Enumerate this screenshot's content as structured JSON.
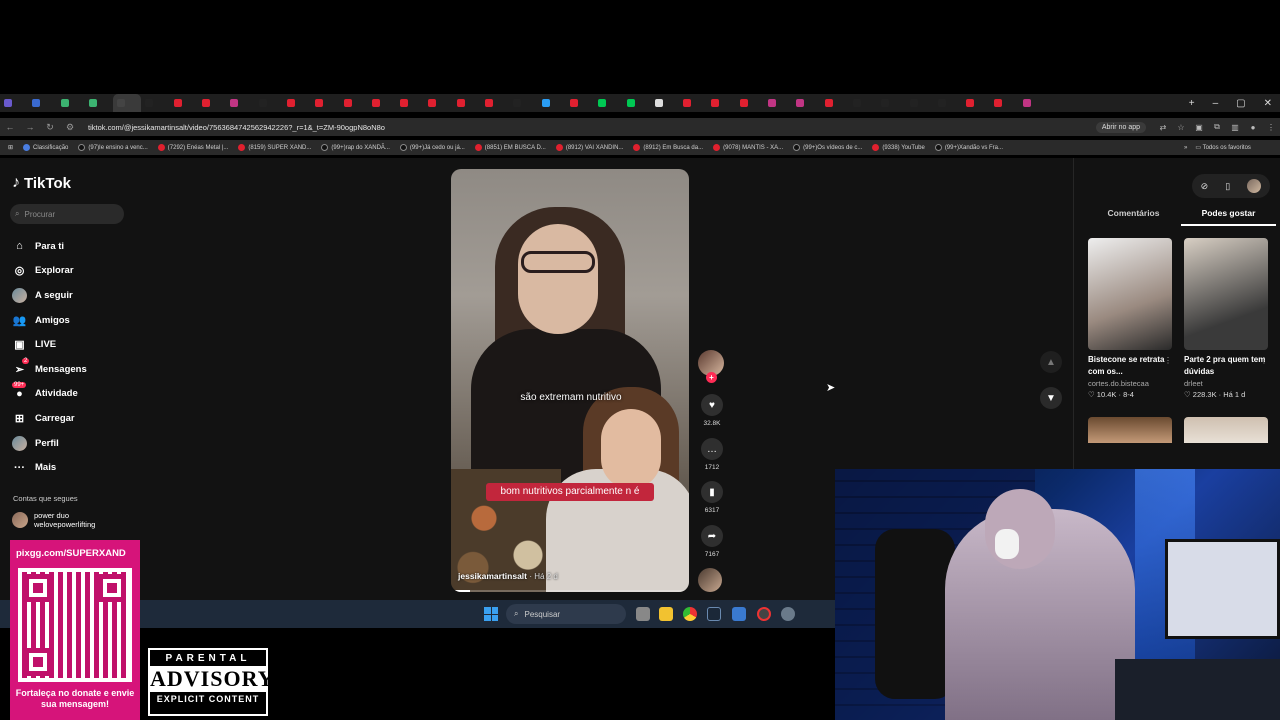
{
  "browser": {
    "url": "tiktok.com/@jessikamartinsalt/video/7563684742562942226?_r=1&_t=ZM-90ogpN8oN8o",
    "open_in_app": "Abrir no app",
    "bookmarks": [
      {
        "label": "Classificação",
        "kind": "g"
      },
      {
        "label": "(97)Ie ensino a venc...",
        "kind": "tt"
      },
      {
        "label": "(7292) Enéas Metal |...",
        "kind": "yt"
      },
      {
        "label": "(8159) SUPER XAND...",
        "kind": "yt"
      },
      {
        "label": "(99+)rap do XANDÃ...",
        "kind": "tt"
      },
      {
        "label": "(99+)Já cedo ou já...",
        "kind": "tt"
      },
      {
        "label": "(8851) EM BUSCA D...",
        "kind": "yt"
      },
      {
        "label": "(8912) VAI XANDIN...",
        "kind": "yt"
      },
      {
        "label": "(8912) Em Busca da...",
        "kind": "yt"
      },
      {
        "label": "(9078) MANTIS - XA...",
        "kind": "yt"
      },
      {
        "label": "(99+)Os vídeos de c...",
        "kind": "tt"
      },
      {
        "label": "(9338) YouTube",
        "kind": "yt"
      },
      {
        "label": "(99+)Xandão vs Fra...",
        "kind": "tt"
      }
    ],
    "all_bookmarks": "Todos os favoritos"
  },
  "tiktok": {
    "logo": "TikTok",
    "search_placeholder": "Procurar",
    "nav": [
      {
        "label": "Para ti",
        "icon": "home-icon",
        "glyph": "⌂"
      },
      {
        "label": "Explorar",
        "icon": "compass-icon",
        "glyph": "◎"
      },
      {
        "label": "A seguir",
        "icon": "following-avatar-icon",
        "glyph": "●"
      },
      {
        "label": "Amigos",
        "icon": "friends-icon",
        "glyph": "👥"
      },
      {
        "label": "LIVE",
        "icon": "live-icon",
        "glyph": "▣"
      },
      {
        "label": "Mensagens",
        "icon": "messages-icon",
        "glyph": "➢"
      },
      {
        "label": "Atividade",
        "icon": "activity-icon",
        "glyph": "●"
      },
      {
        "label": "Carregar",
        "icon": "upload-icon",
        "glyph": "⊞"
      },
      {
        "label": "Perfil",
        "icon": "profile-avatar-icon",
        "glyph": "●"
      },
      {
        "label": "Mais",
        "icon": "more-icon",
        "glyph": "···"
      }
    ],
    "messages_badge": "2",
    "activity_badge": "99+",
    "following_header": "Contas que segues",
    "following_account": {
      "name": "power duo",
      "handle": "welovepowerlifting"
    },
    "video": {
      "caption_top": "são extremam nutritivo",
      "caption_bottom": "bom nutritivos parcialmente n é",
      "author": "jessikamartinsalt",
      "age": "· Há 2 d",
      "progress": 0.08
    },
    "actions": {
      "likes": "32.8K",
      "comments": "1712",
      "saves": "6317",
      "shares": "7167"
    },
    "right_panel": {
      "tabs": [
        "Comentários",
        "Podes gostar"
      ],
      "active_tab": 1,
      "cards": [
        {
          "title": "Bistecone se retrata com os...",
          "author": "cortes.do.bistecaa",
          "stats": "♡ 10.4K · 8-4"
        },
        {
          "title": "Parte 2 pra quem tem dúvidas",
          "author": "drleet",
          "stats": "♡ 228.3K · Há 1 d"
        }
      ]
    }
  },
  "taskbar": {
    "search_placeholder": "Pesquisar"
  },
  "overlay": {
    "qr_url": "pixgg.com/SUPERXAND",
    "qr_message": "Fortaleça no donate e envie sua mensagem!",
    "advisory_top": "PARENTAL",
    "advisory_mid": "ADVISORY",
    "advisory_bottom": "EXPLICIT CONTENT"
  },
  "colors": {
    "tiktok_red": "#fe2c55",
    "qr_pink": "#d6147a"
  }
}
